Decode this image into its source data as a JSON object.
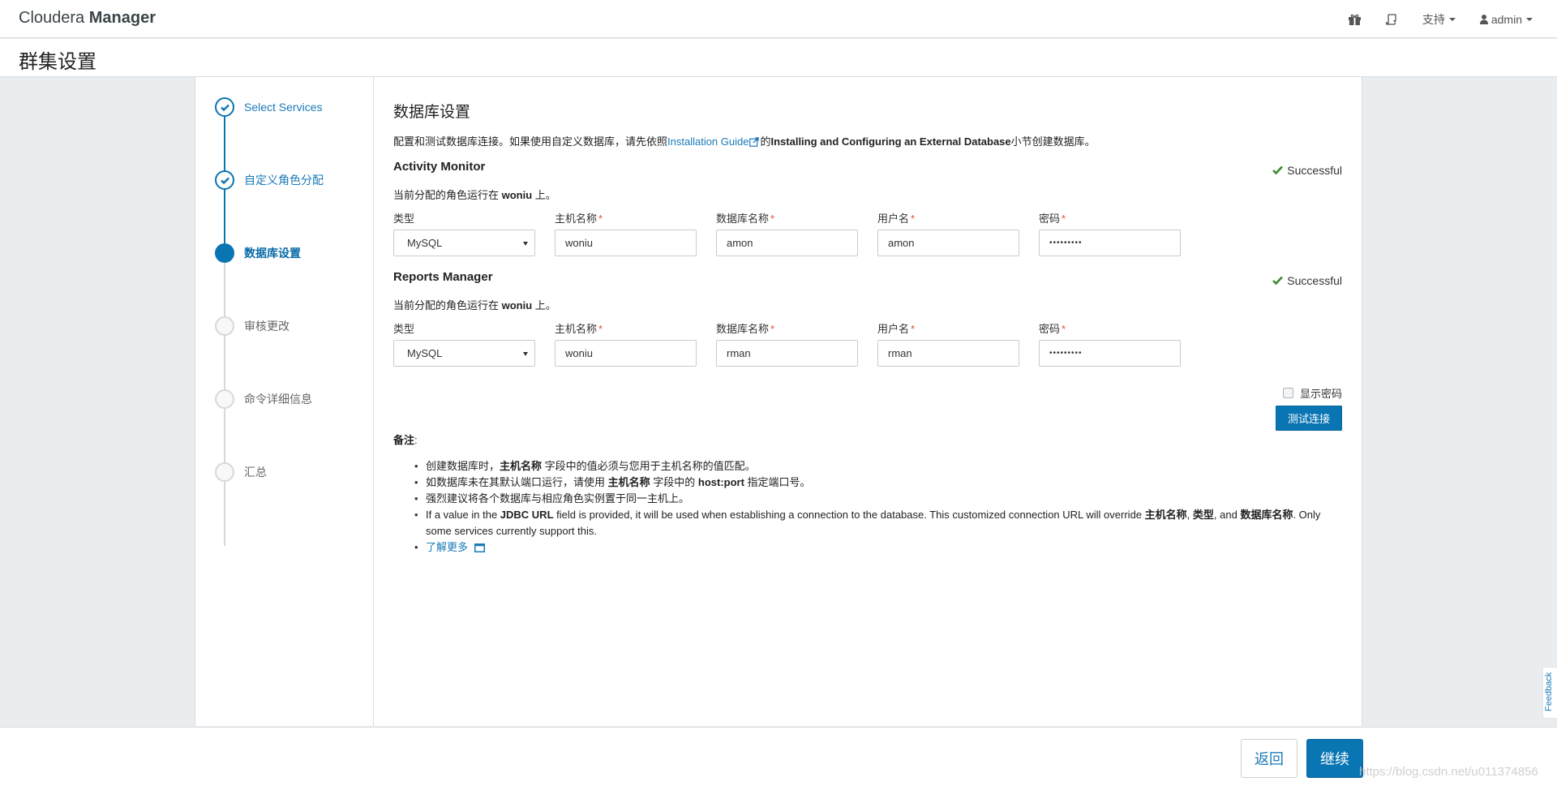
{
  "header": {
    "brand_light": "Cloudera",
    "brand_bold": "Manager",
    "nav": {
      "gift_icon": "gift-icon",
      "help_icon": "scroll-help-icon",
      "support_label": "支持",
      "user_label": "admin"
    }
  },
  "page": {
    "title": "群集设置"
  },
  "wizard": {
    "steps": [
      {
        "label": "Select Services",
        "state": "done"
      },
      {
        "label": "自定义角色分配",
        "state": "done"
      },
      {
        "label": "数据库设置",
        "state": "current"
      },
      {
        "label": "审核更改",
        "state": "pending"
      },
      {
        "label": "命令详细信息",
        "state": "pending"
      },
      {
        "label": "汇总",
        "state": "pending"
      }
    ]
  },
  "main": {
    "title": "数据库设置",
    "intro_prefix": "配置和测试数据库连接。如果使用自定义数据库，请先依照",
    "intro_link": "Installation Guide",
    "intro_mid": "的",
    "intro_bold": "Installing and Configuring an External Database",
    "intro_suffix": "小节创建数据库。",
    "labels": {
      "type": "类型",
      "host": "主机名称",
      "db_name": "数据库名称",
      "username": "用户名",
      "password": "密码",
      "required_mark": "*"
    },
    "databases": [
      {
        "name": "Activity Monitor",
        "status": "Successful",
        "running_prefix": "当前分配的角色运行在 ",
        "running_host": "woniu",
        "running_suffix": " 上。",
        "type": "MySQL",
        "host": "woniu",
        "db_name": "amon",
        "username": "amon",
        "password": "•••••••••"
      },
      {
        "name": "Reports Manager",
        "status": "Successful",
        "running_prefix": "当前分配的角色运行在 ",
        "running_host": "woniu",
        "running_suffix": " 上。",
        "type": "MySQL",
        "host": "woniu",
        "db_name": "rman",
        "username": "rman",
        "password": "•••••••••"
      }
    ],
    "show_password_label": "显示密码",
    "show_password_checked": false,
    "test_button": "测试连接",
    "notes": {
      "title": "备注",
      "colon": ":",
      "n1_a": "创建数据库时，",
      "n1_b": "主机名称",
      "n1_c": " 字段中的值必须与您用于主机名称的值匹配。",
      "n2_a": "如数据库未在其默认端口运行，请使用 ",
      "n2_b": "主机名称",
      "n2_c": " 字段中的 ",
      "n2_d": "host:port",
      "n2_e": " 指定端口号。",
      "n3": "强烈建议将各个数据库与相应角色实例置于同一主机上。",
      "n4_a": "If a value in the ",
      "n4_b": "JDBC URL",
      "n4_c": " field is provided, it will be used when establishing a connection to the database. This customized connection URL will override ",
      "n4_d": "主机名称",
      "n4_e": ", ",
      "n4_f": "类型",
      "n4_g": ", and ",
      "n4_h": "数据库名称",
      "n4_i": ". Only some services currently support this.",
      "learn_more": "了解更多"
    }
  },
  "footer": {
    "back": "返回",
    "next": "继续",
    "watermark": "https://blog.csdn.net/u011374856"
  },
  "feedback": "Feedback",
  "colors": {
    "primary": "#0a75b3",
    "success": "#3c8a2e",
    "required": "#e0502f"
  }
}
